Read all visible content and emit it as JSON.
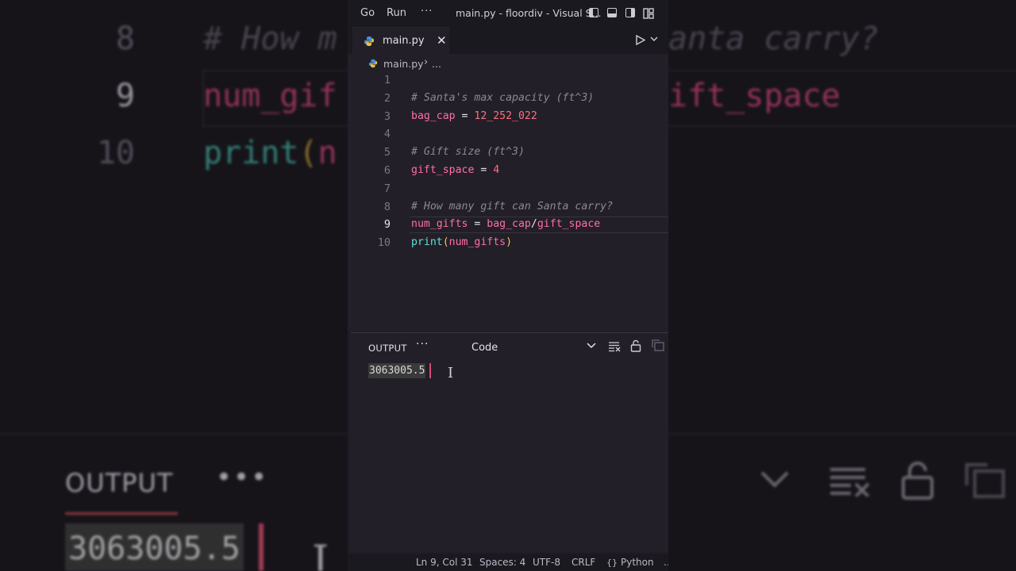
{
  "titlebar": {
    "menu_go": "Go",
    "menu_run": "Run",
    "menu_more": "···",
    "window_title": "main.py - floordiv - Visual S..."
  },
  "tab": {
    "label": "main.py",
    "close": "✕"
  },
  "breadcrumb": {
    "file": "main.py",
    "separator": "›",
    "more": "..."
  },
  "editor": {
    "current_line": 9,
    "lines": [
      {
        "n": "1",
        "tokens": []
      },
      {
        "n": "2",
        "tokens": [
          {
            "t": "# Santa's max capacity (ft^3)",
            "k": "c-com"
          }
        ]
      },
      {
        "n": "3",
        "tokens": [
          {
            "t": "bag_cap",
            "k": "c-var"
          },
          {
            "t": " = ",
            "k": "c-op"
          },
          {
            "t": "12_252_022",
            "k": "c-num"
          }
        ]
      },
      {
        "n": "4",
        "tokens": []
      },
      {
        "n": "5",
        "tokens": [
          {
            "t": "# Gift size (ft^3)",
            "k": "c-com"
          }
        ]
      },
      {
        "n": "6",
        "tokens": [
          {
            "t": "gift_space",
            "k": "c-var"
          },
          {
            "t": " = ",
            "k": "c-op"
          },
          {
            "t": "4",
            "k": "c-num"
          }
        ]
      },
      {
        "n": "7",
        "tokens": []
      },
      {
        "n": "8",
        "tokens": [
          {
            "t": "# How many gift can Santa carry?",
            "k": "c-com"
          }
        ]
      },
      {
        "n": "9",
        "tokens": [
          {
            "t": "num_gifts",
            "k": "c-var"
          },
          {
            "t": " = ",
            "k": "c-op"
          },
          {
            "t": "bag_cap",
            "k": "c-var"
          },
          {
            "t": "/",
            "k": "c-op"
          },
          {
            "t": "gift_space",
            "k": "c-var"
          }
        ]
      },
      {
        "n": "10",
        "tokens": [
          {
            "t": "print",
            "k": "c-fn"
          },
          {
            "t": "(",
            "k": "c-par"
          },
          {
            "t": "num_gifts",
            "k": "c-var"
          },
          {
            "t": ")",
            "k": "c-par"
          }
        ]
      }
    ]
  },
  "panel": {
    "title": "OUTPUT",
    "more": "···",
    "channel": "Code",
    "output_value": "3063005.5"
  },
  "statusbar": {
    "position": "Ln 9, Col 31",
    "spaces": "Spaces: 4",
    "encoding": "UTF-8",
    "eol": "CRLF",
    "language": "Python",
    "overflow": "…"
  },
  "background_zoom": {
    "line_8_num": "8",
    "line_8_left": "# How m",
    "line_8_right": "anta carry?",
    "line_9_num": "9",
    "line_9_left": "num_gif",
    "line_9_right": "ift_space",
    "line_10_num": "10",
    "line_10_fn": "print",
    "line_10_paren": "(",
    "line_10_var": "n",
    "output_label": "OUTPUT",
    "output_dots": "•••",
    "output_value": "3063005.5"
  },
  "colors": {
    "accent_caret": "#d64a6c",
    "keyword_var": "#ff6fa5",
    "number": "#ff6f7f",
    "function": "#62e0d2",
    "bracket": "#f5c64a",
    "comment": "#8d8798"
  },
  "icons": [
    "python-file-icon",
    "close-icon",
    "run-play-icon",
    "chevron-down-icon",
    "layout-icon",
    "clear-output-icon",
    "lock-icon",
    "new-window-icon",
    "bracket-icon"
  ]
}
